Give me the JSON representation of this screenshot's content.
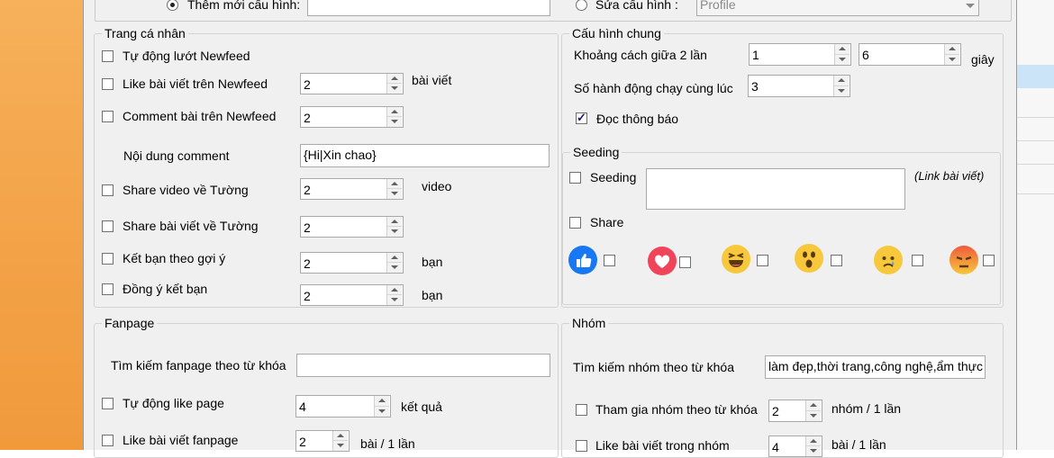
{
  "top": {
    "add_config_label": "Thêm mới cấu hình:",
    "add_config_value": "",
    "edit_config_label": "Sửa cấu hình :",
    "profile_selected": "Profile"
  },
  "personal": {
    "title": "Trang cá nhân",
    "auto_scroll": "Tự động lướt Newfeed",
    "like_newfeed": "Like bài viết trên Newfeed",
    "like_newfeed_count": "2",
    "like_newfeed_unit": "bài viết",
    "comment_newfeed": "Comment bài trên Newfeed",
    "comment_newfeed_count": "2",
    "comment_content_label": "Nội dung comment",
    "comment_content_value": "{Hi|Xin chao}",
    "share_video": "Share video về Tường",
    "share_video_count": "2",
    "share_video_unit": "video",
    "share_post": "Share bài viết về Tường",
    "share_post_count": "2",
    "suggest_friend": "Kết bạn theo gợi ý",
    "suggest_friend_count": "2",
    "suggest_friend_unit": "bạn",
    "accept_friend": "Đồng ý kết bạn",
    "accept_friend_count": "2",
    "accept_friend_unit": "bạn"
  },
  "general": {
    "title": "Cấu hình chung",
    "interval_label": "Khoảng cách giữa 2 lần",
    "interval_min": "1",
    "interval_max": "6",
    "interval_unit": "giây",
    "concurrent_label": "Số hành động chạy cùng lúc",
    "concurrent_value": "3",
    "read_notifications": "Đọc thông báo"
  },
  "seeding": {
    "title": "Seeding",
    "seeding_label": "Seeding",
    "seeding_value": "",
    "link_hint": "(Link bài viết)",
    "share_label": "Share",
    "reactions": [
      "like-icon",
      "love-icon",
      "haha-icon",
      "wow-icon",
      "sad-icon",
      "angry-icon"
    ],
    "colors": {
      "like": "#1877f2",
      "love": "#f0445a",
      "emoji": "#f7c83c",
      "angry": "#f05a3c"
    }
  },
  "fanpage": {
    "title": "Fanpage",
    "search_label": "Tìm kiếm fanpage theo từ khóa",
    "search_value": "",
    "auto_like_page": "Tự động like page",
    "auto_like_page_count": "4",
    "auto_like_page_unit": "kết quả",
    "like_fanpage_post": "Like bài viết fanpage",
    "like_fanpage_post_count": "2",
    "like_fanpage_post_unit": "bài / 1 lần"
  },
  "group": {
    "title": "Nhóm",
    "search_label": "Tìm kiếm nhóm theo từ khóa",
    "search_value": "làm đẹp,thời trang,công nghệ,ẩm thực",
    "join_label": "Tham gia nhóm theo từ khóa",
    "join_count": "2",
    "join_unit": "nhóm / 1 lần",
    "like_group_post": "Like bài viết trong nhóm",
    "like_group_post_count": "4",
    "like_group_post_unit": "bài / 1 lần"
  }
}
